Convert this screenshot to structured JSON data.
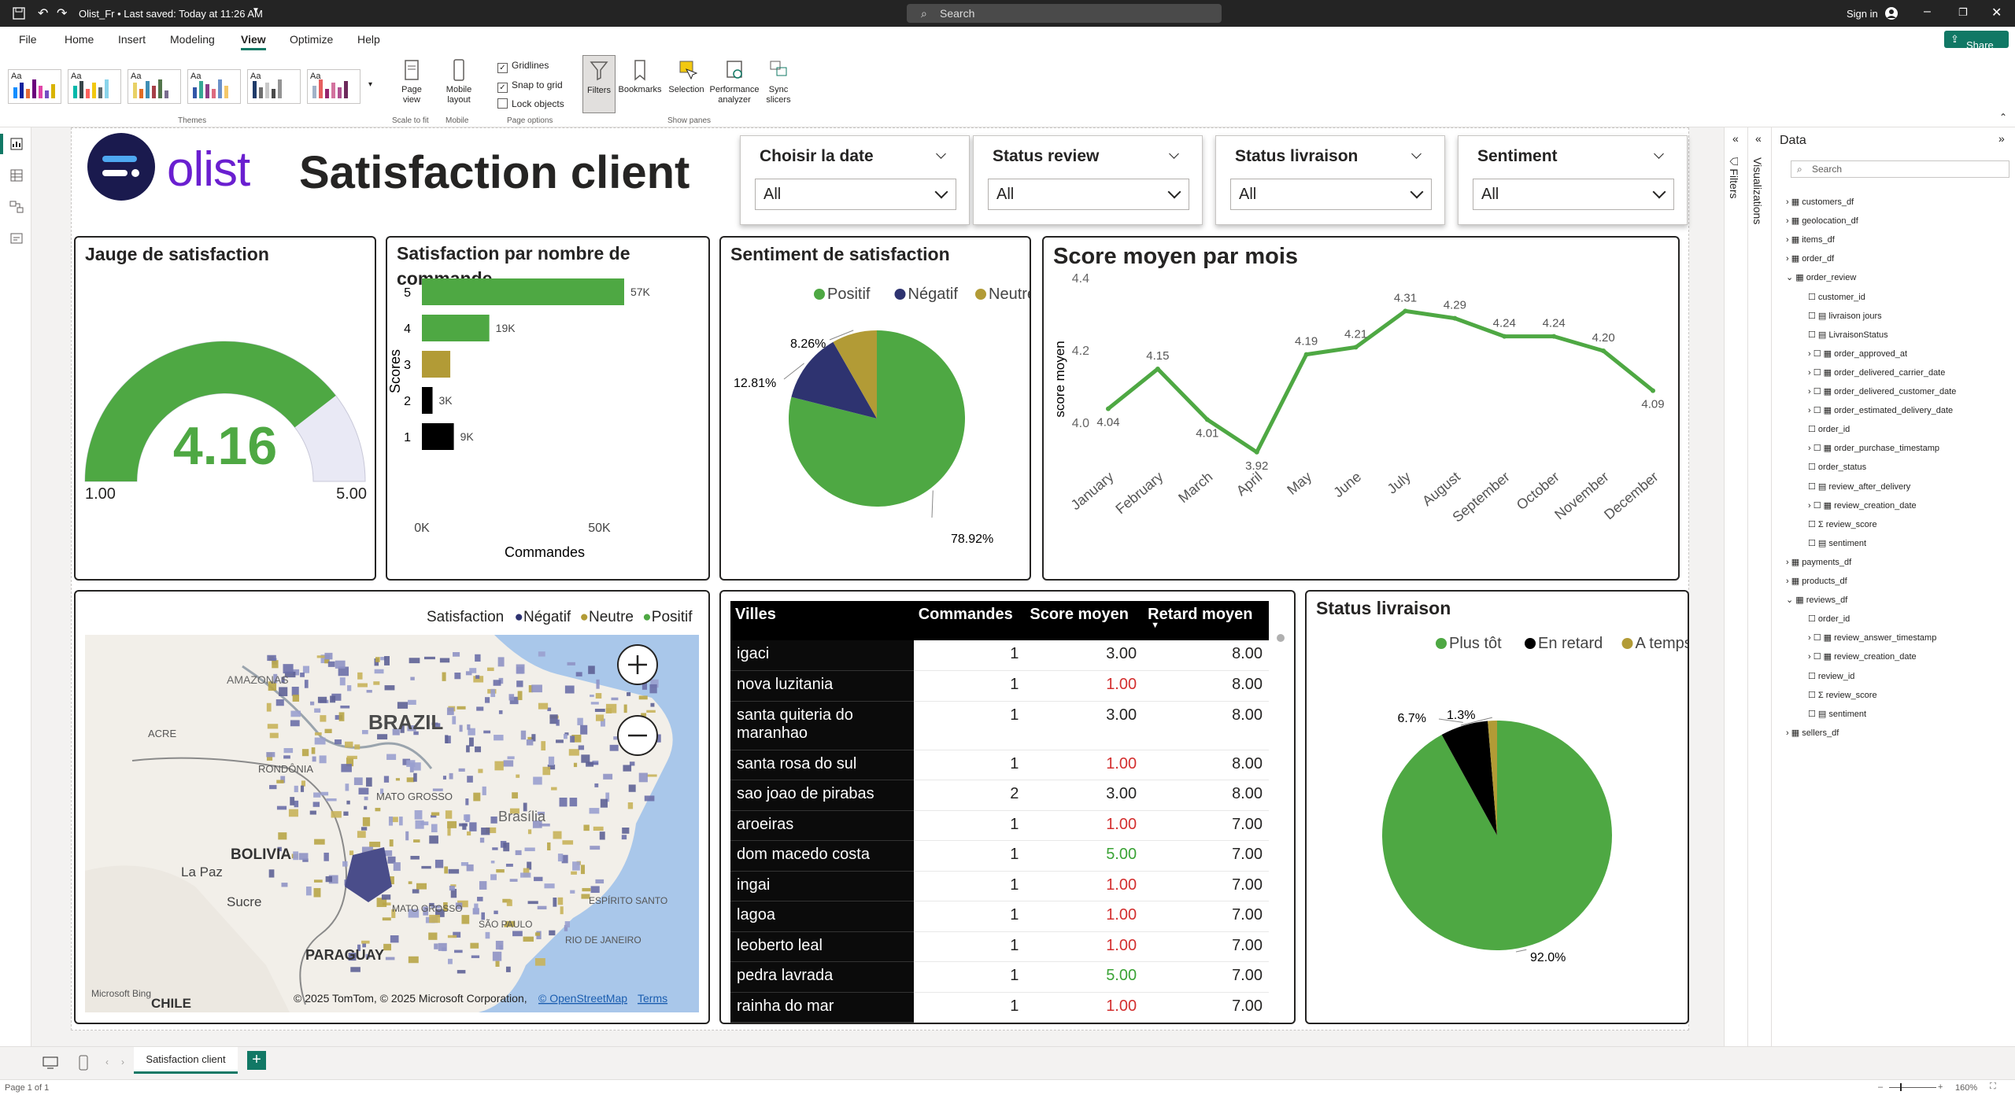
{
  "window": {
    "title": "Olist_Fr • Last saved: Today at 11:26 AM",
    "search_placeholder": "Search",
    "signin": "Sign in",
    "share": "Share"
  },
  "menu": {
    "items": [
      "File",
      "Home",
      "Insert",
      "Modeling",
      "View",
      "Optimize",
      "Help"
    ],
    "active": "View"
  },
  "ribbon": {
    "themes_label": "Themes",
    "page_view": "Page\nview",
    "scale_label": "Scale to fit",
    "mobile_layout": "Mobile\nlayout",
    "mobile_label": "Mobile",
    "gridlines": "Gridlines",
    "snap_to_grid": "Snap to grid",
    "lock_objects": "Lock objects",
    "page_options_label": "Page options",
    "filters": "Filters",
    "bookmarks": "Bookmarks",
    "selection": "Selection",
    "performance_analyzer": "Performance\nanalyzer",
    "sync_slicers": "Sync\nslicers",
    "show_panes_label": "Show panes"
  },
  "report": {
    "logo_text": "olist",
    "title": "Satisfaction client",
    "slicers": [
      {
        "title": "Choisir la date",
        "value": "All"
      },
      {
        "title": "Status review",
        "value": "All"
      },
      {
        "title": "Status livraison",
        "value": "All"
      },
      {
        "title": "Sentiment",
        "value": "All"
      }
    ],
    "gauge": {
      "title": "Jauge de satisfaction",
      "value": "4.16",
      "min_label": "1.00",
      "max_label": "5.00",
      "fraction": 0.79,
      "color": "#4ea843"
    },
    "satisfaction_cmd_title": "Satisfaction par nombre de commande",
    "sentiment_title": "Sentiment de satisfaction",
    "score_mois_title": "Score moyen par mois",
    "map": {
      "legend_title": "Satisfaction",
      "legend": [
        "Négatif",
        "Neutre",
        "Positif"
      ],
      "labels": [
        "AMAZONAS",
        "BRAZIL",
        "ACRE",
        "RONDÔNIA",
        "MATO GROSSO",
        "BOLIVIA",
        "La Paz",
        "Sucre",
        "PARAGUAY",
        "CHILE",
        "Brasília",
        "MATO GROSSO",
        "SÃO PAULO",
        "ESPÍRITO SANTO",
        "RIO DE JANEIRO"
      ],
      "attribution": "© 2025 TomTom, © 2025 Microsoft Corporation,",
      "osm": "© OpenStreetMap",
      "terms": "Terms",
      "bing": "Microsoft Bing"
    },
    "status_title": "Status livraison",
    "table": {
      "headers": [
        "Villes",
        "Commandes",
        "Score moyen",
        "Retard moyen"
      ],
      "rows": [
        {
          "city": "igaci",
          "cmd": "1",
          "score": "3.00",
          "delay": "8.00",
          "color": "#252423"
        },
        {
          "city": "nova luzitania",
          "cmd": "1",
          "score": "1.00",
          "delay": "8.00",
          "color": "#d32f2f"
        },
        {
          "city": "santa quiteria do maranhao",
          "cmd": "1",
          "score": "3.00",
          "delay": "8.00",
          "color": "#252423"
        },
        {
          "city": "santa rosa do sul",
          "cmd": "1",
          "score": "1.00",
          "delay": "8.00",
          "color": "#d32f2f"
        },
        {
          "city": "sao joao de pirabas",
          "cmd": "2",
          "score": "3.00",
          "delay": "8.00",
          "color": "#252423"
        },
        {
          "city": "aroeiras",
          "cmd": "1",
          "score": "1.00",
          "delay": "7.00",
          "color": "#d32f2f"
        },
        {
          "city": "dom macedo costa",
          "cmd": "1",
          "score": "5.00",
          "delay": "7.00",
          "color": "#3aa335"
        },
        {
          "city": "ingai",
          "cmd": "1",
          "score": "1.00",
          "delay": "7.00",
          "color": "#d32f2f"
        },
        {
          "city": "lagoa",
          "cmd": "1",
          "score": "1.00",
          "delay": "7.00",
          "color": "#d32f2f"
        },
        {
          "city": "leoberto leal",
          "cmd": "1",
          "score": "1.00",
          "delay": "7.00",
          "color": "#d32f2f"
        },
        {
          "city": "pedra lavrada",
          "cmd": "1",
          "score": "5.00",
          "delay": "7.00",
          "color": "#3aa335"
        },
        {
          "city": "rainha do mar",
          "cmd": "1",
          "score": "1.00",
          "delay": "7.00",
          "color": "#d32f2f"
        }
      ]
    }
  },
  "panes": {
    "filters": "Filters",
    "visualizations": "Visualizations",
    "data_title": "Data",
    "search_placeholder": "Search",
    "tree": [
      {
        "label": "customers_df",
        "level": 0,
        "type": "table"
      },
      {
        "label": "geolocation_df",
        "level": 0,
        "type": "table"
      },
      {
        "label": "items_df",
        "level": 0,
        "type": "table"
      },
      {
        "label": "order_df",
        "level": 0,
        "type": "table"
      },
      {
        "label": "order_review",
        "level": 0,
        "type": "table-open"
      },
      {
        "label": "customer_id",
        "level": 1,
        "type": "field"
      },
      {
        "label": "livraison jours",
        "level": 1,
        "type": "calc"
      },
      {
        "label": "LivraisonStatus",
        "level": 1,
        "type": "calc"
      },
      {
        "label": "order_approved_at",
        "level": 1,
        "type": "date"
      },
      {
        "label": "order_delivered_carrier_date",
        "level": 1,
        "type": "date"
      },
      {
        "label": "order_delivered_customer_date",
        "level": 1,
        "type": "date"
      },
      {
        "label": "order_estimated_delivery_date",
        "level": 1,
        "type": "date"
      },
      {
        "label": "order_id",
        "level": 1,
        "type": "field"
      },
      {
        "label": "order_purchase_timestamp",
        "level": 1,
        "type": "date"
      },
      {
        "label": "order_status",
        "level": 1,
        "type": "field"
      },
      {
        "label": "review_after_delivery",
        "level": 1,
        "type": "calc"
      },
      {
        "label": "review_creation_date",
        "level": 1,
        "type": "date"
      },
      {
        "label": "review_score",
        "level": 1,
        "type": "sum"
      },
      {
        "label": "sentiment",
        "level": 1,
        "type": "calc"
      },
      {
        "label": "payments_df",
        "level": 0,
        "type": "table"
      },
      {
        "label": "products_df",
        "level": 0,
        "type": "table"
      },
      {
        "label": "reviews_df",
        "level": 0,
        "type": "table-open"
      },
      {
        "label": "order_id",
        "level": 1,
        "type": "field"
      },
      {
        "label": "review_answer_timestamp",
        "level": 1,
        "type": "date"
      },
      {
        "label": "review_creation_date",
        "level": 1,
        "type": "date"
      },
      {
        "label": "review_id",
        "level": 1,
        "type": "field"
      },
      {
        "label": "review_score",
        "level": 1,
        "type": "sum"
      },
      {
        "label": "sentiment",
        "level": 1,
        "type": "calc"
      },
      {
        "label": "sellers_df",
        "level": 0,
        "type": "table"
      }
    ]
  },
  "tabs": {
    "active": "Satisfaction client"
  },
  "status": {
    "page": "Page 1 of 1",
    "zoom": "160%"
  },
  "chart_data": [
    {
      "type": "bar",
      "orientation": "horizontal",
      "title": "Satisfaction par nombre de commande",
      "categories": [
        "5",
        "4",
        "3",
        "2",
        "1"
      ],
      "values": [
        57000,
        19000,
        8000,
        3000,
        9000
      ],
      "data_labels": [
        "57K",
        "19K",
        "",
        "3K",
        "9K"
      ],
      "colors": [
        "#4ea843",
        "#4ea843",
        "#b29b36",
        "#000000",
        "#000000"
      ],
      "xlabel": "Commandes",
      "ylabel": "Scores",
      "xticks": [
        "0K",
        "50K"
      ],
      "xlim": [
        0,
        67000
      ]
    },
    {
      "type": "pie",
      "title": "Sentiment de satisfaction",
      "labels": [
        "Positif",
        "Négatif",
        "Neutre"
      ],
      "values": [
        78.92,
        12.81,
        8.26
      ],
      "data_labels": [
        "78.92%",
        "12.81%",
        "8.26%"
      ],
      "colors": [
        "#4ea843",
        "#2e3370",
        "#b29b36"
      ],
      "legend": "top"
    },
    {
      "type": "line",
      "title": "Score moyen par mois",
      "ylabel": "score moyen",
      "x": [
        "January",
        "February",
        "March",
        "April",
        "May",
        "June",
        "July",
        "August",
        "September",
        "October",
        "November",
        "December"
      ],
      "y": [
        4.04,
        4.15,
        4.01,
        3.92,
        4.19,
        4.21,
        4.31,
        4.29,
        4.24,
        4.24,
        4.2,
        4.09
      ],
      "ylim": [
        3.9,
        4.4
      ],
      "yticks": [
        "4.0",
        "4.2",
        "4.4"
      ],
      "color": "#4ea843"
    },
    {
      "type": "pie",
      "title": "Status livraison",
      "labels": [
        "Plus tôt",
        "En retard",
        "A temps"
      ],
      "values": [
        92.0,
        6.7,
        1.3
      ],
      "data_labels": [
        "92.0%",
        "6.7%",
        "1.3%"
      ],
      "colors": [
        "#4ea843",
        "#000000",
        "#b29b36"
      ],
      "legend": "top-right"
    }
  ]
}
